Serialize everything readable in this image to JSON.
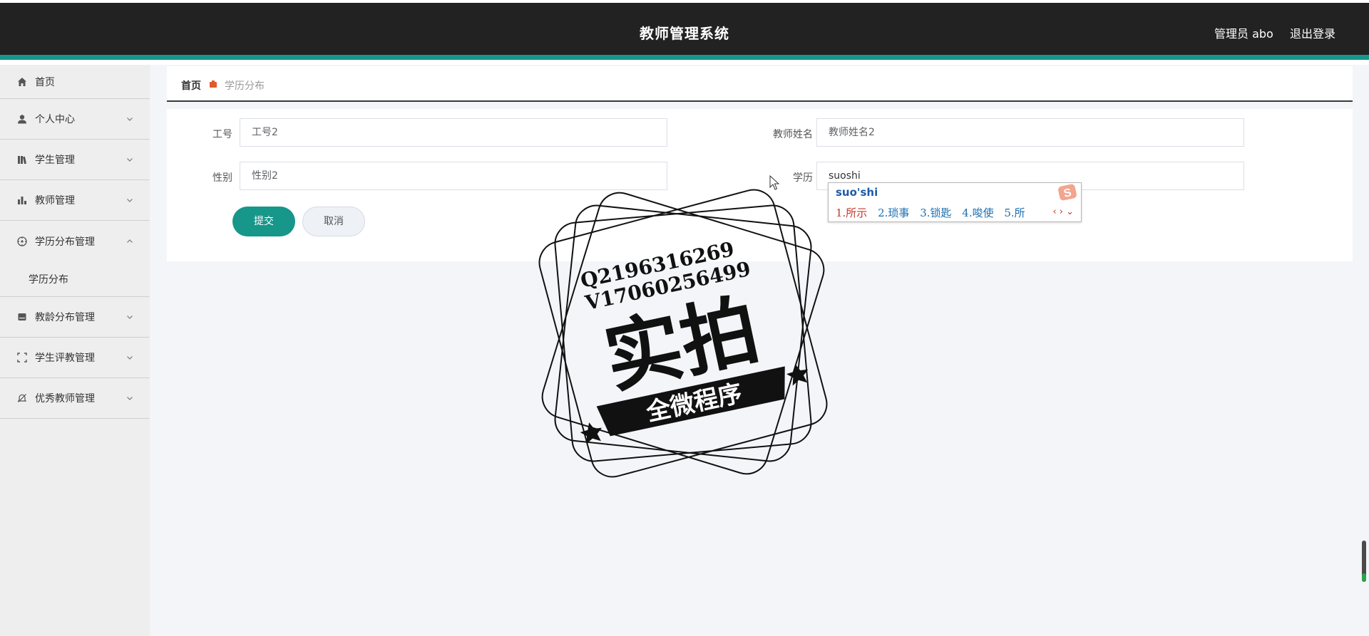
{
  "header": {
    "title": "教师管理系统",
    "user": "管理员 abo",
    "logout": "退出登录"
  },
  "sidebar": {
    "items": [
      {
        "label": "首页",
        "icon": "home-icon"
      },
      {
        "label": "个人中心",
        "icon": "user-icon"
      },
      {
        "label": "学生管理",
        "icon": "books-icon"
      },
      {
        "label": "教师管理",
        "icon": "bar-chart-icon"
      },
      {
        "label": "学历分布管理",
        "icon": "compass-icon",
        "expanded": true,
        "children": [
          "学历分布"
        ]
      },
      {
        "label": "教龄分布管理",
        "icon": "inbox-icon"
      },
      {
        "label": "学生评教管理",
        "icon": "fullscreen-icon"
      },
      {
        "label": "优秀教师管理",
        "icon": "bell-off-icon"
      }
    ]
  },
  "breadcrumb": {
    "home": "首页",
    "current": "学历分布"
  },
  "form": {
    "fields": [
      {
        "label": "工号",
        "value": "工号2"
      },
      {
        "label": "教师姓名",
        "value": "教师姓名2"
      },
      {
        "label": "性别",
        "value": "性别2"
      },
      {
        "label": "学历",
        "value": "suoshi"
      }
    ],
    "submit": "提交",
    "cancel": "取消"
  },
  "ime": {
    "composition": "suo'shi",
    "candidates": [
      "1.所示",
      "2.琐事",
      "3.锁匙",
      "4.唆使",
      "5.所"
    ],
    "nav": "‹ › ⌄"
  },
  "watermark": {
    "line1": "Q2196316269",
    "line2": "V17060256499",
    "main": "实拍",
    "banner": "全微程序"
  },
  "colors": {
    "header_bg": "#222222",
    "accent": "#17968a",
    "sidebar_bg": "#eeeeee",
    "content_bg": "#f3f5f9"
  }
}
